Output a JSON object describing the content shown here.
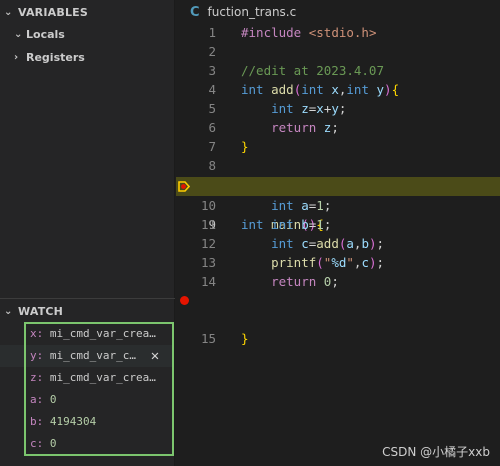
{
  "sidebar": {
    "variables_header": "VARIABLES",
    "locals_label": "Locals",
    "registers_label": "Registers",
    "watch_header": "WATCH",
    "watch_items": [
      {
        "name": "x:",
        "value": " mi_cmd_var_crea…"
      },
      {
        "name": "y:",
        "value": " mi_cmd_var_c…"
      },
      {
        "name": "z:",
        "value": " mi_cmd_var_crea…"
      },
      {
        "name": "a:",
        "value": " 0"
      },
      {
        "name": "b:",
        "value": " 4194304"
      },
      {
        "name": "c:",
        "value": " 0"
      }
    ]
  },
  "editor": {
    "tab_icon": "C",
    "tab_title": "fuction_trans.c",
    "current_line": 9,
    "breakpoint_line": 15,
    "line_numbers": [
      "1",
      "2",
      "3",
      "4",
      "5",
      "6",
      "7",
      "8",
      "9",
      "10",
      "11",
      "12",
      "13",
      "14",
      "15"
    ]
  },
  "watermark": "CSDN @小橘子xxb",
  "colors": {
    "watch_border": "#7cc56e",
    "current_line_bg": "#4b4b18",
    "breakpoint": "#e51400",
    "current_arrow": "#ffcc00"
  }
}
